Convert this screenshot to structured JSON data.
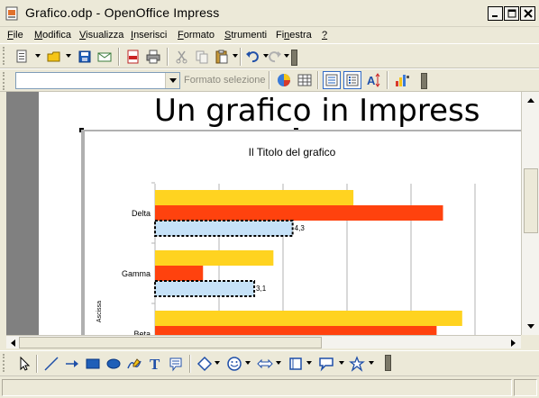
{
  "window": {
    "title": "Grafico.odp - OpenOffice Impress"
  },
  "menu": {
    "items": [
      {
        "label": "File",
        "ul": "F",
        "rest": "ile"
      },
      {
        "label": "Modifica",
        "ul": "M",
        "rest": "odifica"
      },
      {
        "label": "Visualizza",
        "ul": "V",
        "rest": "isualizza"
      },
      {
        "label": "Inserisci",
        "ul": "I",
        "rest": "nserisci"
      },
      {
        "label": "Formato",
        "ul": "F",
        "rest": "ormato"
      },
      {
        "label": "Strumenti",
        "ul": "S",
        "rest": "trumenti"
      },
      {
        "label": "Finestra",
        "pre": "Fi",
        "ul": "n",
        "rest": "estra"
      },
      {
        "label": "?",
        "ul": "?",
        "rest": ""
      }
    ]
  },
  "toolbar2": {
    "combo_value": "",
    "format_selection_label": "Formato selezione"
  },
  "slide": {
    "title": "Un grafico in Impress"
  },
  "chart_data": {
    "type": "bar",
    "orientation": "horizontal",
    "title": "Il Titolo del grafico",
    "ylabel": "Ascissa",
    "categories": [
      "Delta",
      "Gamma",
      "Beta"
    ],
    "series": [
      {
        "color": "#ffd320",
        "values": [
          6.2,
          3.7,
          9.6
        ]
      },
      {
        "color": "#ff420e",
        "values": [
          9.0,
          1.5,
          8.8
        ]
      },
      {
        "color": "#c6e2f8",
        "values": [
          4.3,
          3.1,
          null
        ],
        "data_labels": [
          "4,3",
          "3,1",
          ""
        ]
      }
    ],
    "xlim": [
      0,
      10
    ],
    "grid": true
  },
  "colors": {
    "workspace": "#808080",
    "chrome": "#ece9d8",
    "accent_blue": "#1f5fb8"
  }
}
